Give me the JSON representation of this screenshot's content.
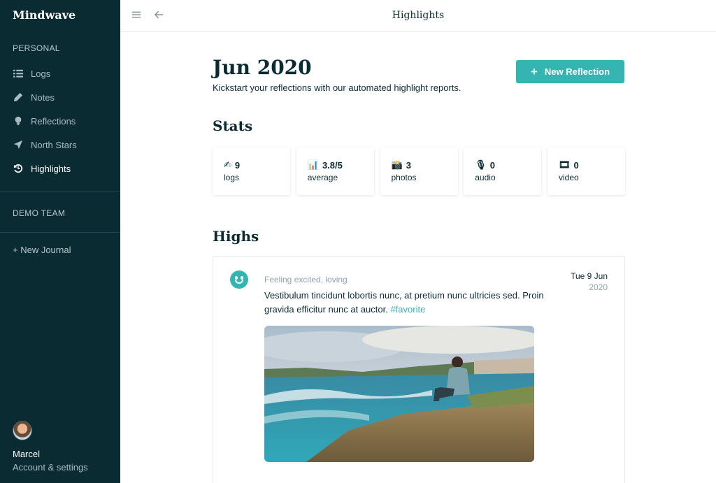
{
  "sidebar": {
    "brand": "Mindwave",
    "personal_label": "PERSONAL",
    "items": [
      {
        "label": "Logs"
      },
      {
        "label": "Notes"
      },
      {
        "label": "Reflections"
      },
      {
        "label": "North Stars"
      },
      {
        "label": "Highlights"
      }
    ],
    "team_label": "DEMO TEAM",
    "new_journal": "+ New Journal",
    "user": {
      "name": "Marcel",
      "settings": "Account & settings"
    }
  },
  "topbar": {
    "title": "Highlights"
  },
  "page": {
    "title": "Jun 2020",
    "subtitle": "Kickstart your reflections with our automated highlight reports.",
    "new_button": "New Reflection"
  },
  "stats": {
    "heading": "Stats",
    "cards": [
      {
        "emoji": "✍",
        "value": "9",
        "label": "logs"
      },
      {
        "emoji": "📊",
        "value": "3.8/5",
        "label": "average"
      },
      {
        "emoji": "📸",
        "value": "3",
        "label": "photos"
      },
      {
        "emoji": "🎙",
        "value": "0",
        "label": "audio"
      },
      {
        "emoji": "🎞",
        "value": "0",
        "label": "video"
      }
    ]
  },
  "highs": {
    "heading": "Highs",
    "entry": {
      "feeling": "Feeling excited, loving",
      "text": "Vestibulum tincidunt lobortis nunc, at pretium nunc ultricies sed. Proin gravida efficitur nunc at auctor.",
      "tag": "#favorite",
      "date_day": "Tue 9 Jun",
      "date_year": "2020"
    }
  },
  "colors": {
    "sidebar": "#0b2b33",
    "accent": "#35b5b2"
  }
}
